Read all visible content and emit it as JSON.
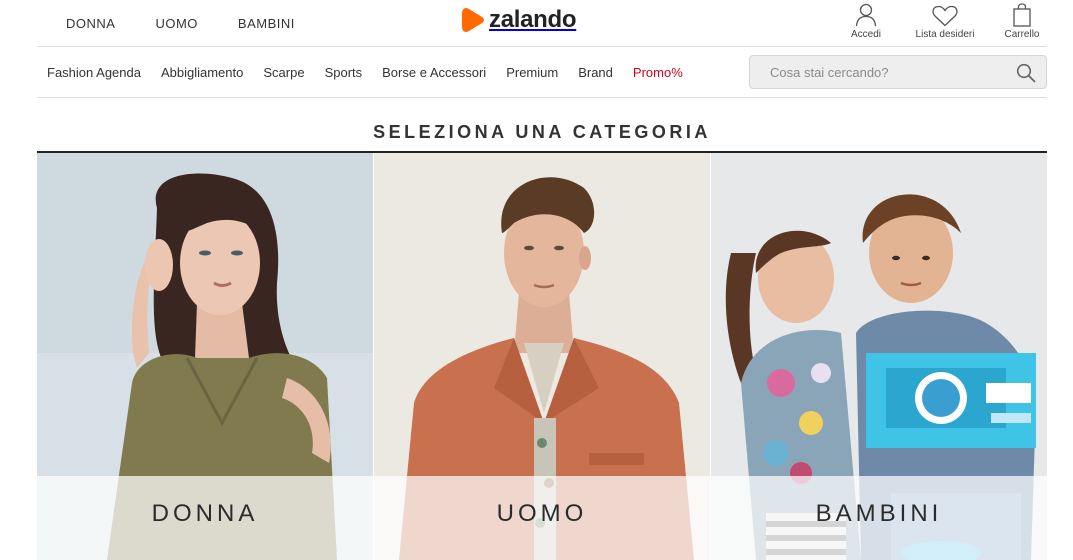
{
  "header": {
    "gender_nav": [
      "DONNA",
      "UOMO",
      "BAMBINI"
    ],
    "logo_text": "zalando",
    "logo_icon": "zalando-logo-mark",
    "accent_color": "#ff6900",
    "actions": {
      "login": {
        "label": "Accedi",
        "icon": "user-icon"
      },
      "wishlist": {
        "label": "Lista desideri",
        "icon": "heart-icon"
      },
      "cart": {
        "label": "Carrello",
        "icon": "bag-icon"
      }
    }
  },
  "category_nav": {
    "items": [
      "Fashion Agenda",
      "Abbigliamento",
      "Scarpe",
      "Sports",
      "Borse e Accessori",
      "Premium",
      "Brand",
      "Promo%"
    ],
    "promo_color": "#d0021b"
  },
  "search": {
    "placeholder": "Cosa stai cercando?",
    "value": "",
    "icon": "search-icon"
  },
  "main": {
    "section_title": "SELEZIONA UNA CATEGORIA",
    "tiles": [
      {
        "label": "DONNA",
        "image": "woman-in-olive-dress-photo"
      },
      {
        "label": "UOMO",
        "image": "man-in-orange-jacket-photo"
      },
      {
        "label": "BAMBINI",
        "image": "two-children-photo"
      }
    ]
  }
}
